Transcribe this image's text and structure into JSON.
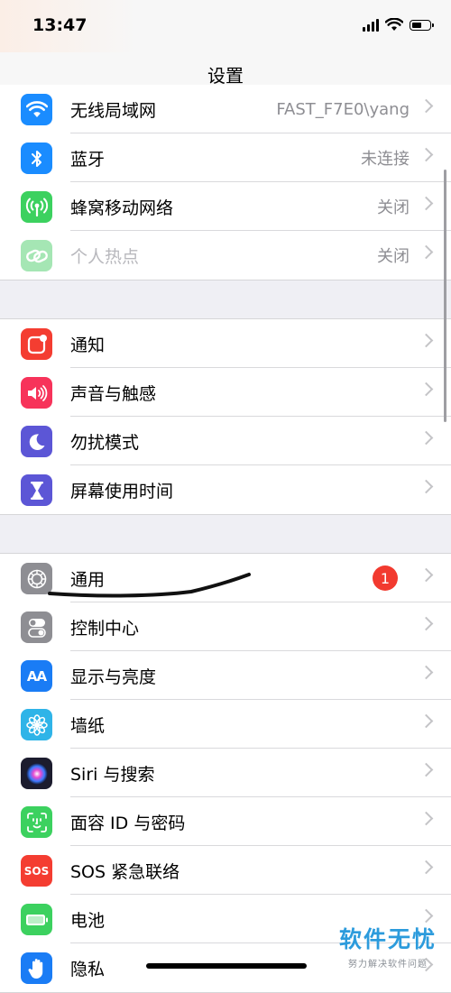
{
  "status_bar": {
    "time": "13:47"
  },
  "nav": {
    "title": "设置"
  },
  "groups": [
    [
      {
        "label": "无线局域网",
        "value": "FAST_F7E0\\yang",
        "icon": "wifi-icon",
        "color": "#1a8cff"
      },
      {
        "label": "蓝牙",
        "value": "未连接",
        "icon": "bluetooth-icon",
        "color": "#1a8cff"
      },
      {
        "label": "蜂窝移动网络",
        "value": "关闭",
        "icon": "cellular-antenna-icon",
        "color": "#3cd15f"
      },
      {
        "label": "个人热点",
        "value": "关闭",
        "icon": "hotspot-link-icon",
        "color": "#a5e6b4"
      }
    ],
    [
      {
        "label": "通知",
        "icon": "notification-icon",
        "color": "#f43d31"
      },
      {
        "label": "声音与触感",
        "icon": "speaker-icon",
        "color": "#f7335a"
      },
      {
        "label": "勿扰模式",
        "icon": "moon-icon",
        "color": "#5c56d6"
      },
      {
        "label": "屏幕使用时间",
        "icon": "hourglass-icon",
        "color": "#5c56d6"
      }
    ],
    [
      {
        "label": "通用",
        "badge": "1",
        "icon": "gear-icon",
        "color": "#8e8e93"
      },
      {
        "label": "控制中心",
        "icon": "toggle-switches-icon",
        "color": "#8e8e93"
      },
      {
        "label": "显示与亮度",
        "icon_text": "AA",
        "icon": "text-size-icon",
        "color": "#1a7cf5"
      },
      {
        "label": "墙纸",
        "icon": "flower-icon",
        "color": "#2fb4e8"
      },
      {
        "label": "Siri 与搜索",
        "icon": "siri-icon",
        "color": "#1c1c2e"
      },
      {
        "label": "面容 ID 与密码",
        "icon": "face-id-icon",
        "color": "#3cd15f"
      },
      {
        "label": "SOS 紧急联络",
        "icon_text": "SOS",
        "icon": "sos-icon",
        "color": "#f43d31"
      },
      {
        "label": "电池",
        "icon": "battery-icon",
        "color": "#3cd15f"
      },
      {
        "label": "隐私",
        "icon": "hand-icon",
        "color": "#1a7cf5"
      }
    ]
  ],
  "watermark": {
    "title": "软件无忧",
    "subtitle": "努力解决软件问题"
  }
}
